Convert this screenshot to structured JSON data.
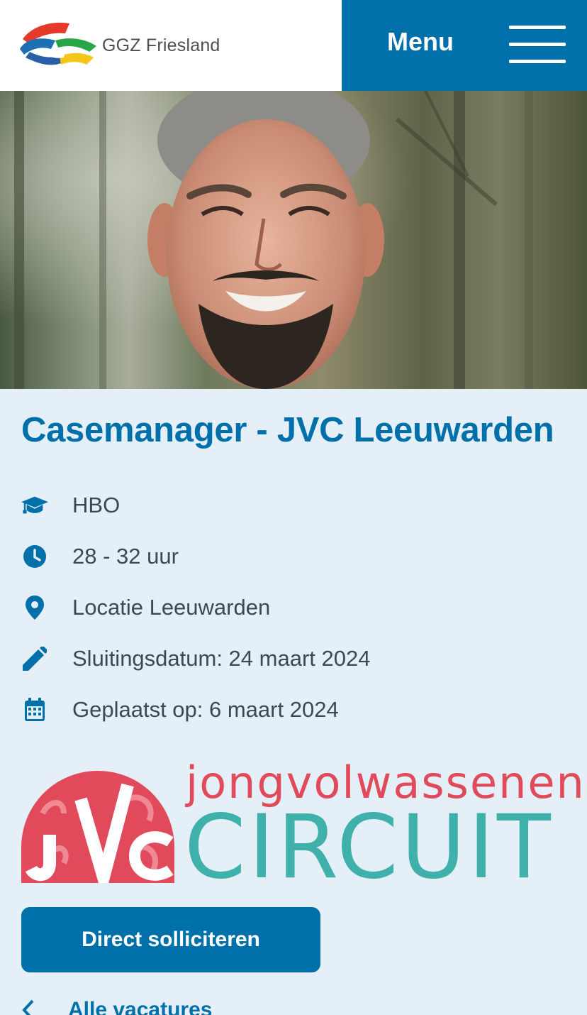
{
  "header": {
    "brand_name": "GGZ Friesland",
    "menu_label": "Menu"
  },
  "hero": {
    "image": "portrait photo of smiling man in forest"
  },
  "job": {
    "title": "Casemanager - JVC Leeuwarden",
    "meta": [
      {
        "icon": "graduation-cap-icon",
        "text": "HBO"
      },
      {
        "icon": "clock-icon",
        "text": "28 - 32 uur"
      },
      {
        "icon": "location-pin-icon",
        "text": "Locatie Leeuwarden"
      },
      {
        "icon": "pencil-icon",
        "text": "Sluitingsdatum: 24 maart 2024"
      },
      {
        "icon": "calendar-icon",
        "text": "Geplaatst op: 6 maart 2024"
      }
    ]
  },
  "jvc_logo": {
    "badge_letters": "JVC",
    "line1": "jongvolwassenen",
    "line2": "CIRCUIT"
  },
  "actions": {
    "apply_label": "Direct solliciteren",
    "back_label": "Alle vacatures"
  },
  "colors": {
    "primary": "#0070aa",
    "background": "#e4eff7",
    "text": "#3d4852",
    "jvc_red": "#e04a5a",
    "jvc_teal": "#3fb0aa"
  }
}
